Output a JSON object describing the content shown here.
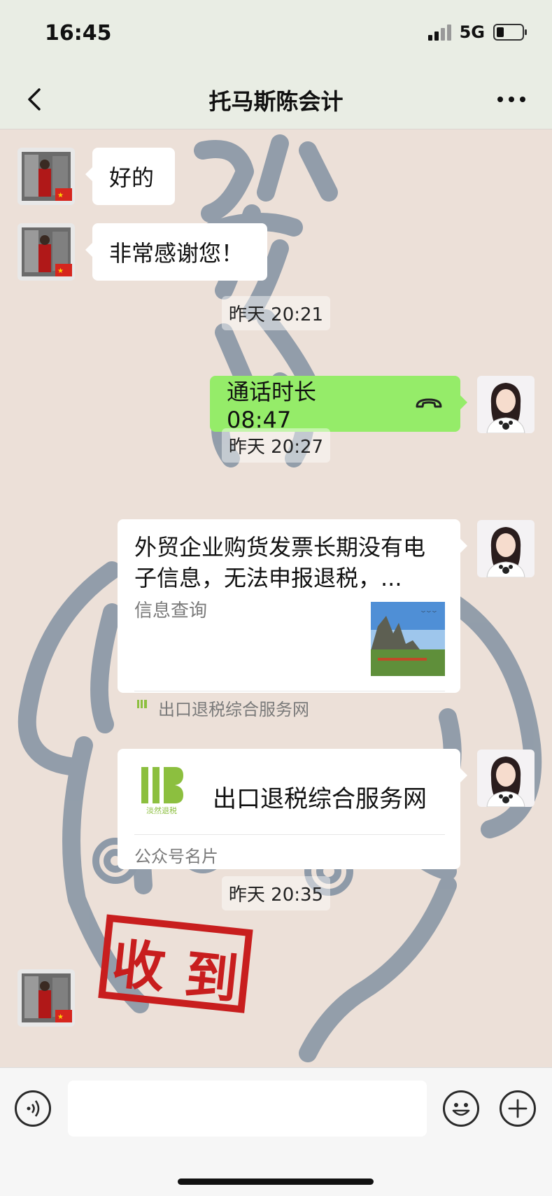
{
  "status_bar": {
    "time": "16:45",
    "network": "5G"
  },
  "nav": {
    "title": "托马斯陈会计"
  },
  "messages": {
    "m1": "好的",
    "m2": "非常感谢您！",
    "ts1": "昨天 20:21",
    "call": "通话时长 08:47",
    "ts2": "昨天 20:27",
    "link_title": "外贸企业购货发票长期没有电子信息，无法申报退税，...",
    "link_desc": "信息查询",
    "link_source": "出口退税综合服务网",
    "card_name": "出口退税综合服务网",
    "card_logo_text": "淡然退税",
    "card_type": "公众号名片",
    "ts3": "昨天 20:35"
  },
  "stamp": {
    "text": "收到"
  },
  "colors": {
    "chat_bg": "#ece0d8",
    "green_bubble": "#95ec69",
    "logo_green": "#8cbf3f"
  }
}
